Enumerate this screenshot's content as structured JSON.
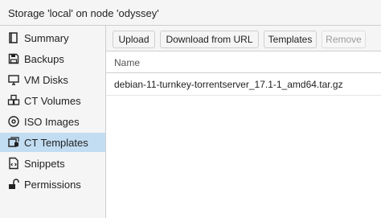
{
  "window": {
    "title": "Storage 'local' on node 'odyssey'"
  },
  "sidebar": {
    "items": [
      {
        "label": "Summary",
        "icon": "book-icon",
        "active": false
      },
      {
        "label": "Backups",
        "icon": "floppy-icon",
        "active": false
      },
      {
        "label": "VM Disks",
        "icon": "desktop-icon",
        "active": false
      },
      {
        "label": "CT Volumes",
        "icon": "cubes-icon",
        "active": false
      },
      {
        "label": "ISO Images",
        "icon": "disc-icon",
        "active": false
      },
      {
        "label": "CT Templates",
        "icon": "template-icon",
        "active": true
      },
      {
        "label": "Snippets",
        "icon": "file-code-icon",
        "active": false
      },
      {
        "label": "Permissions",
        "icon": "unlock-icon",
        "active": false
      }
    ]
  },
  "toolbar": {
    "upload_label": "Upload",
    "download_url_label": "Download from URL",
    "templates_label": "Templates",
    "remove_label": "Remove"
  },
  "grid": {
    "columns": [
      "Name"
    ],
    "rows": [
      {
        "name": "debian-11-turnkey-torrentserver_17.1-1_amd64.tar.gz"
      }
    ]
  },
  "colors": {
    "active_item": "#c2ddf2",
    "panel_bg": "#f5f5f5",
    "border": "#cfcfcf"
  }
}
